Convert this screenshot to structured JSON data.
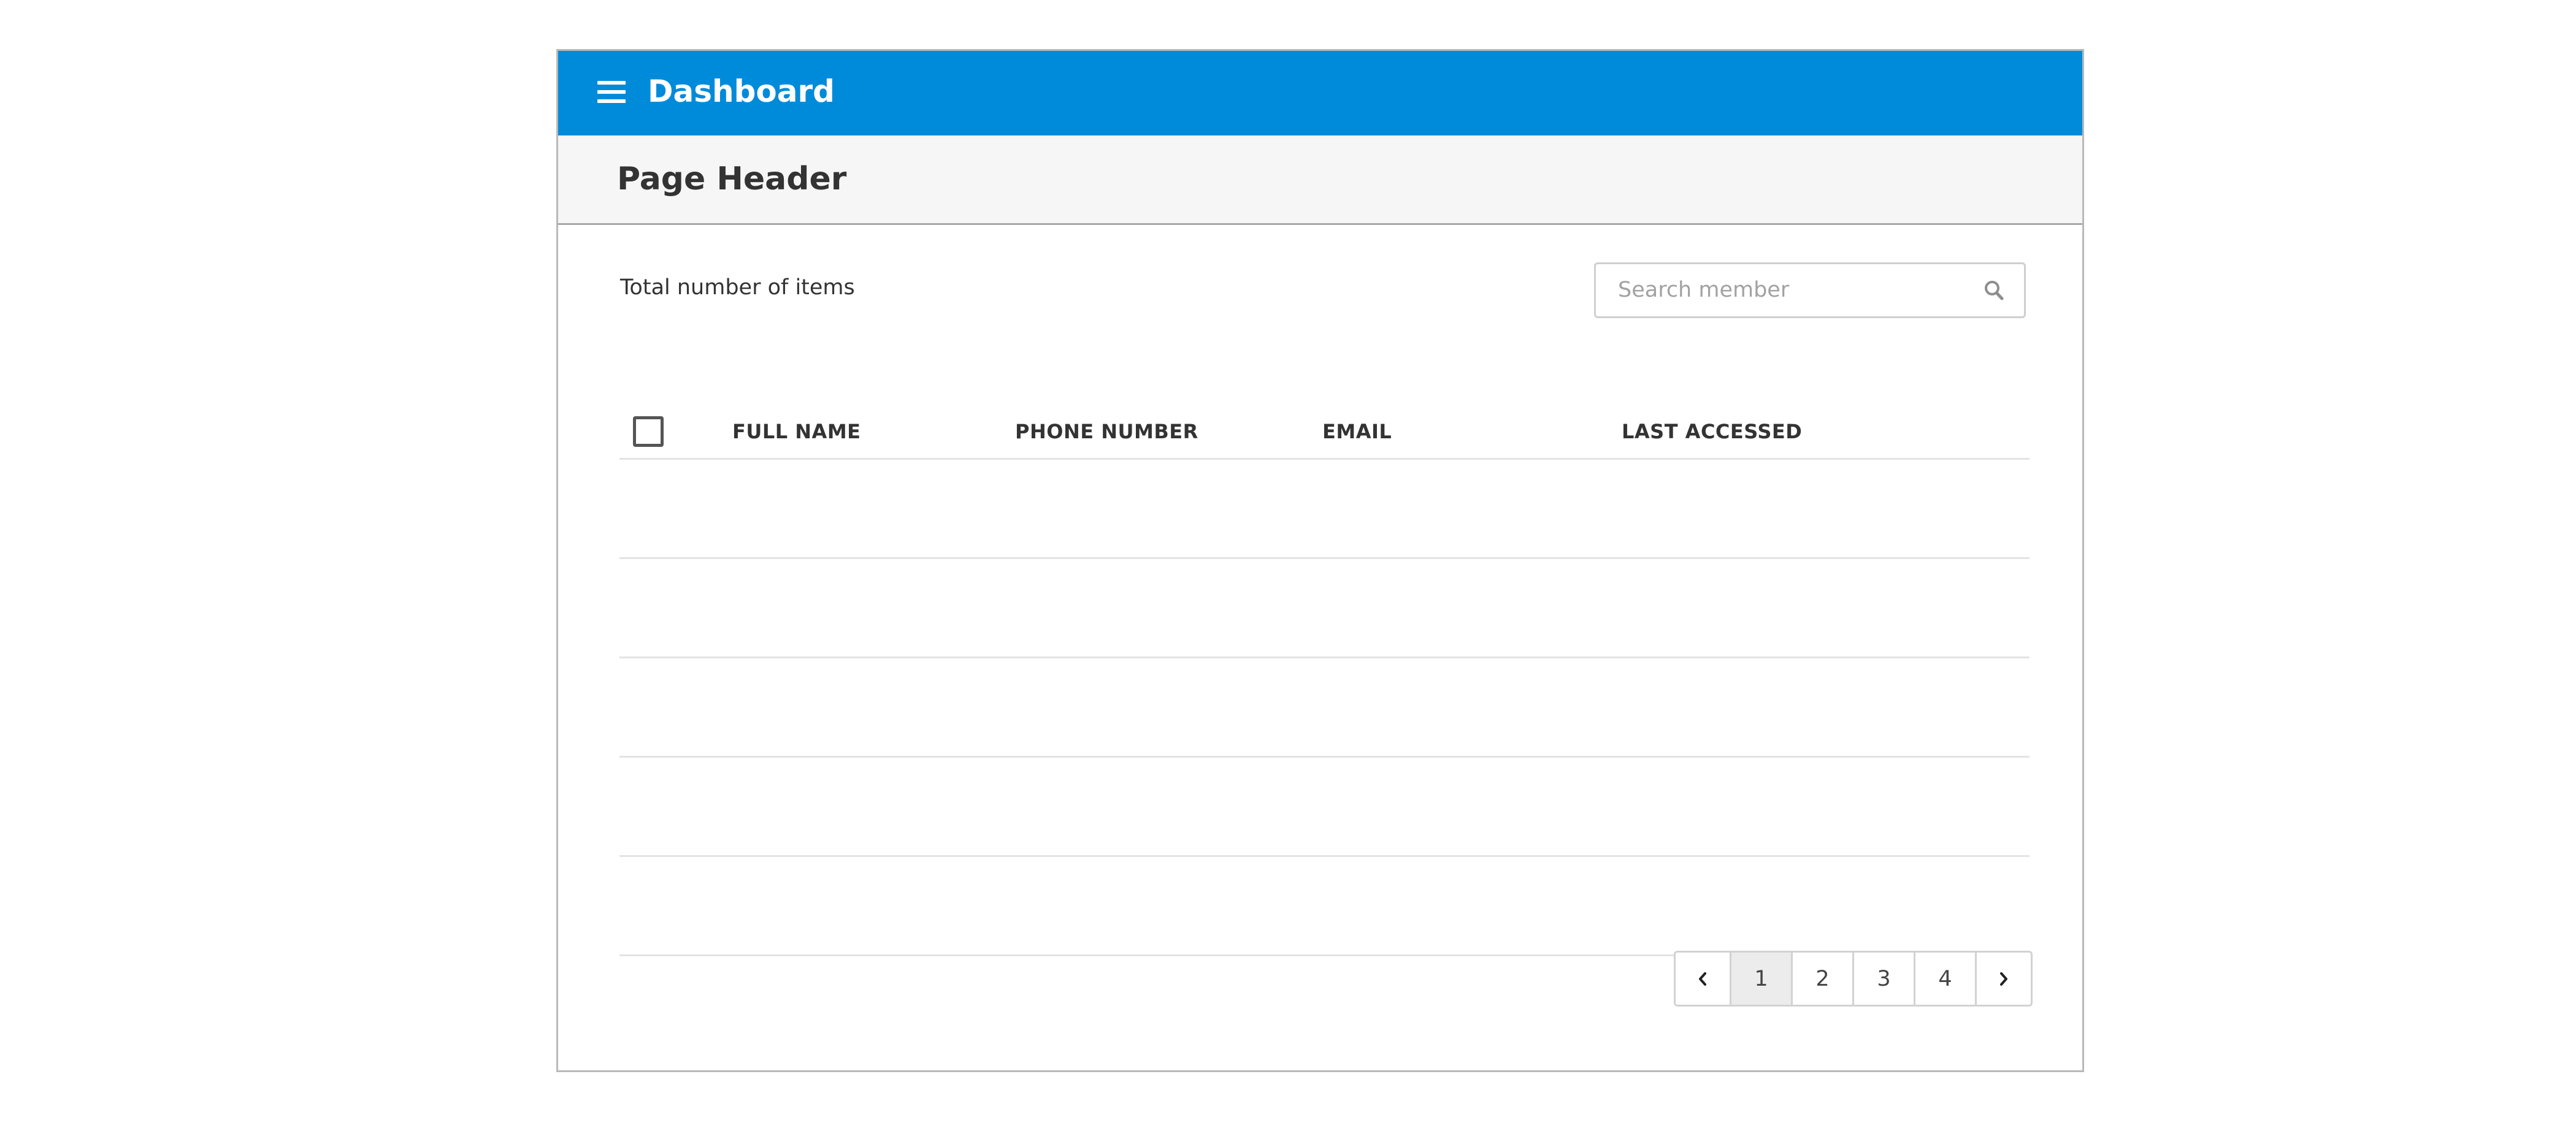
{
  "header": {
    "title": "Dashboard"
  },
  "page": {
    "title": "Page Header"
  },
  "toolbar": {
    "total_label": "Total number of items"
  },
  "search": {
    "placeholder": "Search member",
    "value": ""
  },
  "table": {
    "columns": [
      "FULL NAME",
      "PHONE NUMBER",
      "EMAIL",
      "LAST ACCESSED"
    ],
    "select_all_checked": false,
    "rows": [
      {
        "full_name": "",
        "phone_number": "",
        "email": "",
        "last_accessed": ""
      },
      {
        "full_name": "",
        "phone_number": "",
        "email": "",
        "last_accessed": ""
      },
      {
        "full_name": "",
        "phone_number": "",
        "email": "",
        "last_accessed": ""
      },
      {
        "full_name": "",
        "phone_number": "",
        "email": "",
        "last_accessed": ""
      },
      {
        "full_name": "",
        "phone_number": "",
        "email": "",
        "last_accessed": ""
      }
    ]
  },
  "pagination": {
    "pages": [
      "1",
      "2",
      "3",
      "4"
    ],
    "current_page": "1",
    "prev_icon": "chevron-left-icon",
    "next_icon": "chevron-right-icon"
  },
  "icons": {
    "menu": "hamburger-icon",
    "search": "search-icon",
    "checkbox": "checkbox-icon"
  },
  "colors": {
    "header_bg": "#008bda",
    "page_header_bg": "#f6f6f6",
    "active_page_bg": "#ececec"
  }
}
